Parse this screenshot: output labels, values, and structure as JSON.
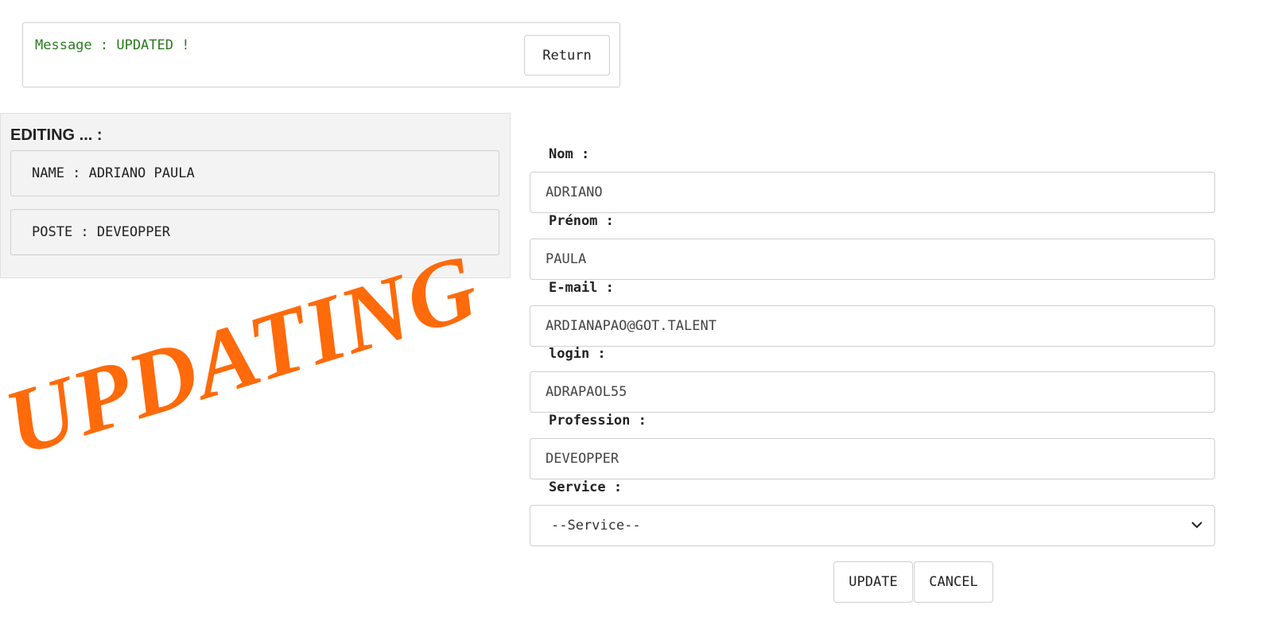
{
  "message": {
    "text": "Message : UPDATED !",
    "return_label": "Return"
  },
  "editing": {
    "title": "EDITING ... :",
    "name_line": "NAME : ADRIANO PAULA",
    "poste_line": "POSTE : DEVEOPPER"
  },
  "stamp": {
    "text": "UPDATING",
    "color": "#ff6a0a"
  },
  "form": {
    "nom": {
      "label": "Nom :",
      "value": "ADRIANO"
    },
    "prenom": {
      "label": "Prénom :",
      "value": "PAULA"
    },
    "email": {
      "label": "E-mail :",
      "value": "ARDIANAPAO@GOT.TALENT"
    },
    "login": {
      "label": "login :",
      "value": "ADRAPAOL55"
    },
    "profession": {
      "label": "Profession :",
      "value": "DEVEOPPER"
    },
    "service": {
      "label": "Service :",
      "selected": "--Service--",
      "icon": "chevron-down-icon"
    }
  },
  "actions": {
    "update_label": "UPDATE",
    "cancel_label": "CANCEL"
  },
  "colors": {
    "message_green": "#2a7a1e",
    "border": "#cfcfcf",
    "panel_bg": "#f3f3f3"
  }
}
